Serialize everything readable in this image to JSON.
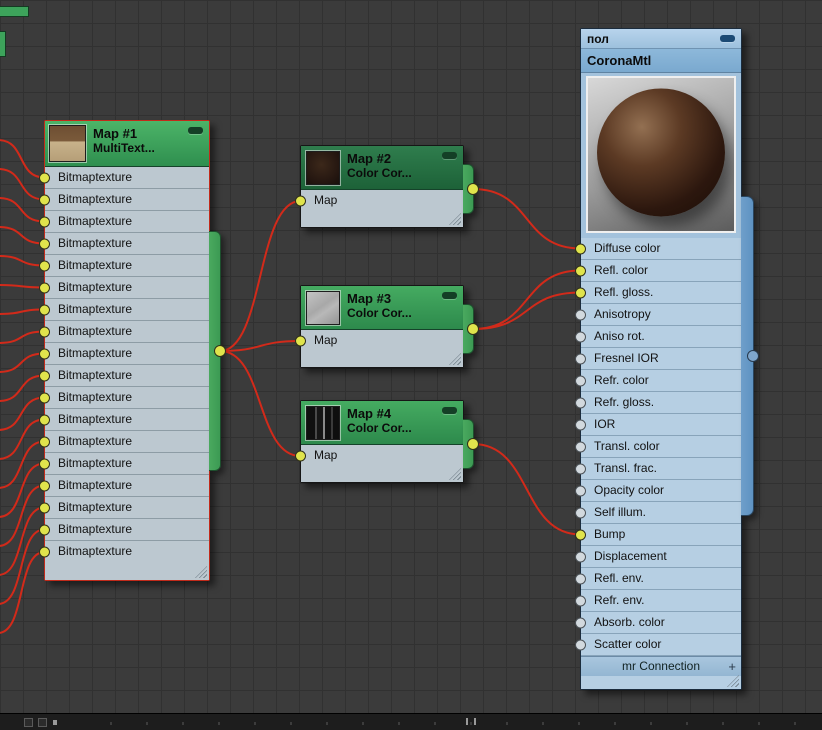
{
  "background": {
    "color": "#3b3b3b",
    "grid_color": "#313131"
  },
  "wire_color": "#d22a1a",
  "nodes": {
    "multitexture": {
      "title": "Map #1",
      "subtitle": "MultiText...",
      "slots": [
        "Bitmaptexture",
        "Bitmaptexture",
        "Bitmaptexture",
        "Bitmaptexture",
        "Bitmaptexture",
        "Bitmaptexture",
        "Bitmaptexture",
        "Bitmaptexture",
        "Bitmaptexture",
        "Bitmaptexture",
        "Bitmaptexture",
        "Bitmaptexture",
        "Bitmaptexture",
        "Bitmaptexture",
        "Bitmaptexture",
        "Bitmaptexture",
        "Bitmaptexture",
        "Bitmaptexture"
      ]
    },
    "map2": {
      "title": "Map #2",
      "subtitle": "Color Cor...",
      "slots": [
        "Map"
      ]
    },
    "map3": {
      "title": "Map #3",
      "subtitle": "Color Cor...",
      "slots": [
        "Map"
      ]
    },
    "map4": {
      "title": "Map #4",
      "subtitle": "Color Cor...",
      "slots": [
        "Map"
      ]
    },
    "corona": {
      "name": "пол",
      "title": "CoronaMtl",
      "slots": [
        "Diffuse color",
        "Refl. color",
        "Refl. gloss.",
        "Anisotropy",
        "Aniso rot.",
        "Fresnel IOR",
        "Refr. color",
        "Refr. gloss.",
        "IOR",
        "Transl. color",
        "Transl. frac.",
        "Opacity color",
        "Self illum.",
        "Bump",
        "Displacement",
        "Refl. env.",
        "Refr. env.",
        "Absorb. color",
        "Scatter color"
      ],
      "connected_slots": [
        "Diffuse color",
        "Refl. color",
        "Refl. gloss.",
        "Bump"
      ],
      "footer_label": "mr Connection",
      "footer_plus": "+"
    }
  },
  "connections": [
    {
      "from_node": "multitexture",
      "from_port": "out",
      "to_node": "map2",
      "to_slot": "Map"
    },
    {
      "from_node": "multitexture",
      "from_port": "out",
      "to_node": "map3",
      "to_slot": "Map"
    },
    {
      "from_node": "multitexture",
      "from_port": "out",
      "to_node": "map4",
      "to_slot": "Map"
    },
    {
      "from_node": "map2",
      "from_port": "out",
      "to_node": "corona",
      "to_slot": "Diffuse color"
    },
    {
      "from_node": "map3",
      "from_port": "out",
      "to_node": "corona",
      "to_slot": "Refl. color"
    },
    {
      "from_node": "map3",
      "from_port": "out",
      "to_node": "corona",
      "to_slot": "Refl. gloss."
    },
    {
      "from_node": "map4",
      "from_port": "out",
      "to_node": "corona",
      "to_slot": "Bump"
    }
  ],
  "external_wires": {
    "count": 18,
    "into_node": "multitexture"
  }
}
